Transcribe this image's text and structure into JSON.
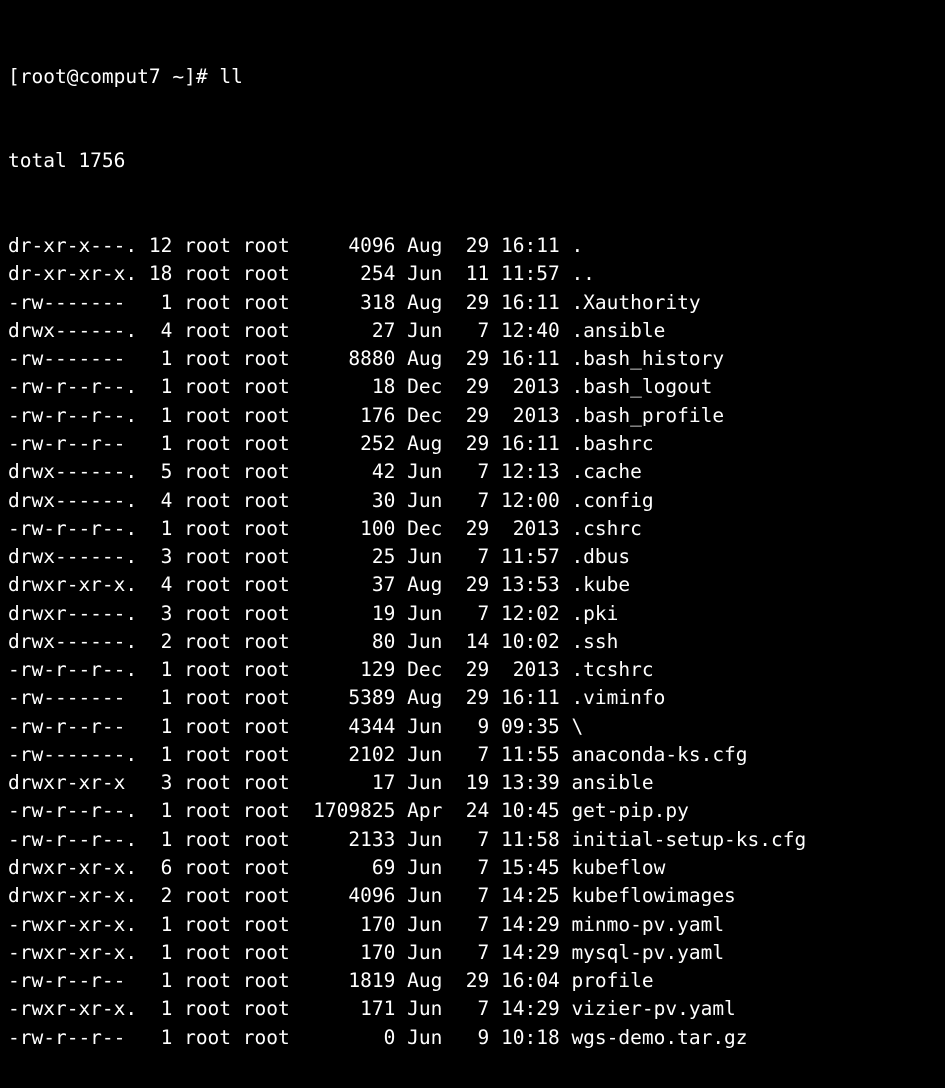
{
  "prompt": "[root@comput7 ~]# ",
  "command": "ll",
  "total_label": "total 1756",
  "entries": [
    {
      "perm": "dr-xr-x---.",
      "links": "12",
      "owner": "root",
      "group": "root",
      "size": "4096",
      "mon": "Aug",
      "day": "29",
      "time": "16:11",
      "name": "."
    },
    {
      "perm": "dr-xr-xr-x.",
      "links": "18",
      "owner": "root",
      "group": "root",
      "size": "254",
      "mon": "Jun",
      "day": "11",
      "time": "11:57",
      "name": ".."
    },
    {
      "perm": "-rw-------",
      "links": "1",
      "owner": "root",
      "group": "root",
      "size": "318",
      "mon": "Aug",
      "day": "29",
      "time": "16:11",
      "name": ".Xauthority"
    },
    {
      "perm": "drwx------.",
      "links": "4",
      "owner": "root",
      "group": "root",
      "size": "27",
      "mon": "Jun",
      "day": "7",
      "time": "12:40",
      "name": ".ansible"
    },
    {
      "perm": "-rw-------",
      "links": "1",
      "owner": "root",
      "group": "root",
      "size": "8880",
      "mon": "Aug",
      "day": "29",
      "time": "16:11",
      "name": ".bash_history"
    },
    {
      "perm": "-rw-r--r--.",
      "links": "1",
      "owner": "root",
      "group": "root",
      "size": "18",
      "mon": "Dec",
      "day": "29",
      "time": "2013",
      "name": ".bash_logout"
    },
    {
      "perm": "-rw-r--r--.",
      "links": "1",
      "owner": "root",
      "group": "root",
      "size": "176",
      "mon": "Dec",
      "day": "29",
      "time": "2013",
      "name": ".bash_profile"
    },
    {
      "perm": "-rw-r--r--",
      "links": "1",
      "owner": "root",
      "group": "root",
      "size": "252",
      "mon": "Aug",
      "day": "29",
      "time": "16:11",
      "name": ".bashrc"
    },
    {
      "perm": "drwx------.",
      "links": "5",
      "owner": "root",
      "group": "root",
      "size": "42",
      "mon": "Jun",
      "day": "7",
      "time": "12:13",
      "name": ".cache"
    },
    {
      "perm": "drwx------.",
      "links": "4",
      "owner": "root",
      "group": "root",
      "size": "30",
      "mon": "Jun",
      "day": "7",
      "time": "12:00",
      "name": ".config"
    },
    {
      "perm": "-rw-r--r--.",
      "links": "1",
      "owner": "root",
      "group": "root",
      "size": "100",
      "mon": "Dec",
      "day": "29",
      "time": "2013",
      "name": ".cshrc"
    },
    {
      "perm": "drwx------.",
      "links": "3",
      "owner": "root",
      "group": "root",
      "size": "25",
      "mon": "Jun",
      "day": "7",
      "time": "11:57",
      "name": ".dbus"
    },
    {
      "perm": "drwxr-xr-x.",
      "links": "4",
      "owner": "root",
      "group": "root",
      "size": "37",
      "mon": "Aug",
      "day": "29",
      "time": "13:53",
      "name": ".kube"
    },
    {
      "perm": "drwxr-----.",
      "links": "3",
      "owner": "root",
      "group": "root",
      "size": "19",
      "mon": "Jun",
      "day": "7",
      "time": "12:02",
      "name": ".pki"
    },
    {
      "perm": "drwx------.",
      "links": "2",
      "owner": "root",
      "group": "root",
      "size": "80",
      "mon": "Jun",
      "day": "14",
      "time": "10:02",
      "name": ".ssh"
    },
    {
      "perm": "-rw-r--r--.",
      "links": "1",
      "owner": "root",
      "group": "root",
      "size": "129",
      "mon": "Dec",
      "day": "29",
      "time": "2013",
      "name": ".tcshrc"
    },
    {
      "perm": "-rw-------",
      "links": "1",
      "owner": "root",
      "group": "root",
      "size": "5389",
      "mon": "Aug",
      "day": "29",
      "time": "16:11",
      "name": ".viminfo"
    },
    {
      "perm": "-rw-r--r--",
      "links": "1",
      "owner": "root",
      "group": "root",
      "size": "4344",
      "mon": "Jun",
      "day": "9",
      "time": "09:35",
      "name": "\\"
    },
    {
      "perm": "-rw-------.",
      "links": "1",
      "owner": "root",
      "group": "root",
      "size": "2102",
      "mon": "Jun",
      "day": "7",
      "time": "11:55",
      "name": "anaconda-ks.cfg"
    },
    {
      "perm": "drwxr-xr-x",
      "links": "3",
      "owner": "root",
      "group": "root",
      "size": "17",
      "mon": "Jun",
      "day": "19",
      "time": "13:39",
      "name": "ansible"
    },
    {
      "perm": "-rw-r--r--.",
      "links": "1",
      "owner": "root",
      "group": "root",
      "size": "1709825",
      "mon": "Apr",
      "day": "24",
      "time": "10:45",
      "name": "get-pip.py"
    },
    {
      "perm": "-rw-r--r--.",
      "links": "1",
      "owner": "root",
      "group": "root",
      "size": "2133",
      "mon": "Jun",
      "day": "7",
      "time": "11:58",
      "name": "initial-setup-ks.cfg"
    },
    {
      "perm": "drwxr-xr-x.",
      "links": "6",
      "owner": "root",
      "group": "root",
      "size": "69",
      "mon": "Jun",
      "day": "7",
      "time": "15:45",
      "name": "kubeflow"
    },
    {
      "perm": "drwxr-xr-x.",
      "links": "2",
      "owner": "root",
      "group": "root",
      "size": "4096",
      "mon": "Jun",
      "day": "7",
      "time": "14:25",
      "name": "kubeflowimages"
    },
    {
      "perm": "-rwxr-xr-x.",
      "links": "1",
      "owner": "root",
      "group": "root",
      "size": "170",
      "mon": "Jun",
      "day": "7",
      "time": "14:29",
      "name": "minmo-pv.yaml"
    },
    {
      "perm": "-rwxr-xr-x.",
      "links": "1",
      "owner": "root",
      "group": "root",
      "size": "170",
      "mon": "Jun",
      "day": "7",
      "time": "14:29",
      "name": "mysql-pv.yaml"
    },
    {
      "perm": "-rw-r--r--",
      "links": "1",
      "owner": "root",
      "group": "root",
      "size": "1819",
      "mon": "Aug",
      "day": "29",
      "time": "16:04",
      "name": "profile"
    },
    {
      "perm": "-rwxr-xr-x.",
      "links": "1",
      "owner": "root",
      "group": "root",
      "size": "171",
      "mon": "Jun",
      "day": "7",
      "time": "14:29",
      "name": "vizier-pv.yaml"
    },
    {
      "perm": "-rw-r--r--",
      "links": "1",
      "owner": "root",
      "group": "root",
      "size": "0",
      "mon": "Jun",
      "day": "9",
      "time": "10:18",
      "name": "wgs-demo.tar.gz"
    }
  ]
}
